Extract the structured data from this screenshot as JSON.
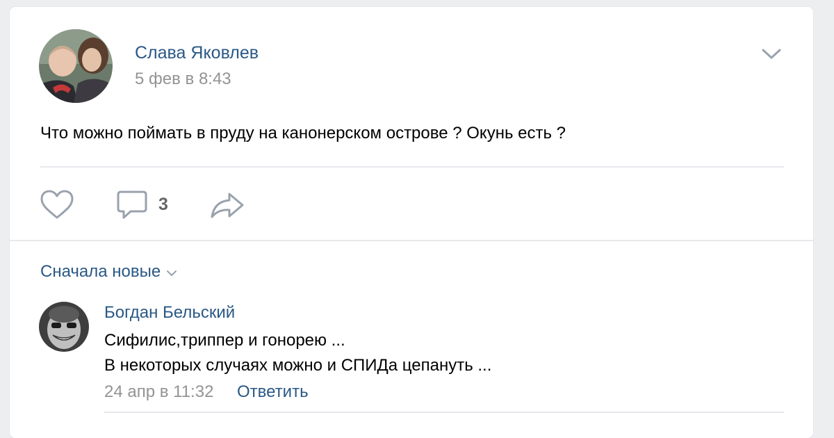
{
  "post": {
    "author": {
      "name": "Слава Яковлев",
      "avatar": "author-photo"
    },
    "date": "5 фев в 8:43",
    "text": "Что можно поймать в пруду на канонерском острове ? Окунь есть ?",
    "actions": {
      "like_icon": "heart-icon",
      "comment_icon": "speech-bubble-icon",
      "comment_count": "3",
      "share_icon": "share-arrow-icon"
    },
    "more_icon": "chevron-down-icon"
  },
  "comments_section": {
    "sort_label": "Сначала новые",
    "comments": [
      {
        "author": "Богдан Бельский",
        "lines": [
          "Сифилис,триппер и гонорею ...",
          "В некоторых случаях можно и СПИДа цепануть ..."
        ],
        "date": "24 апр в 11:32",
        "reply_label": "Ответить"
      }
    ]
  },
  "colors": {
    "background": "#edeef0",
    "card": "#ffffff",
    "link": "#2a5885",
    "secondary_text": "#939393",
    "icon": "#99a2ad"
  }
}
